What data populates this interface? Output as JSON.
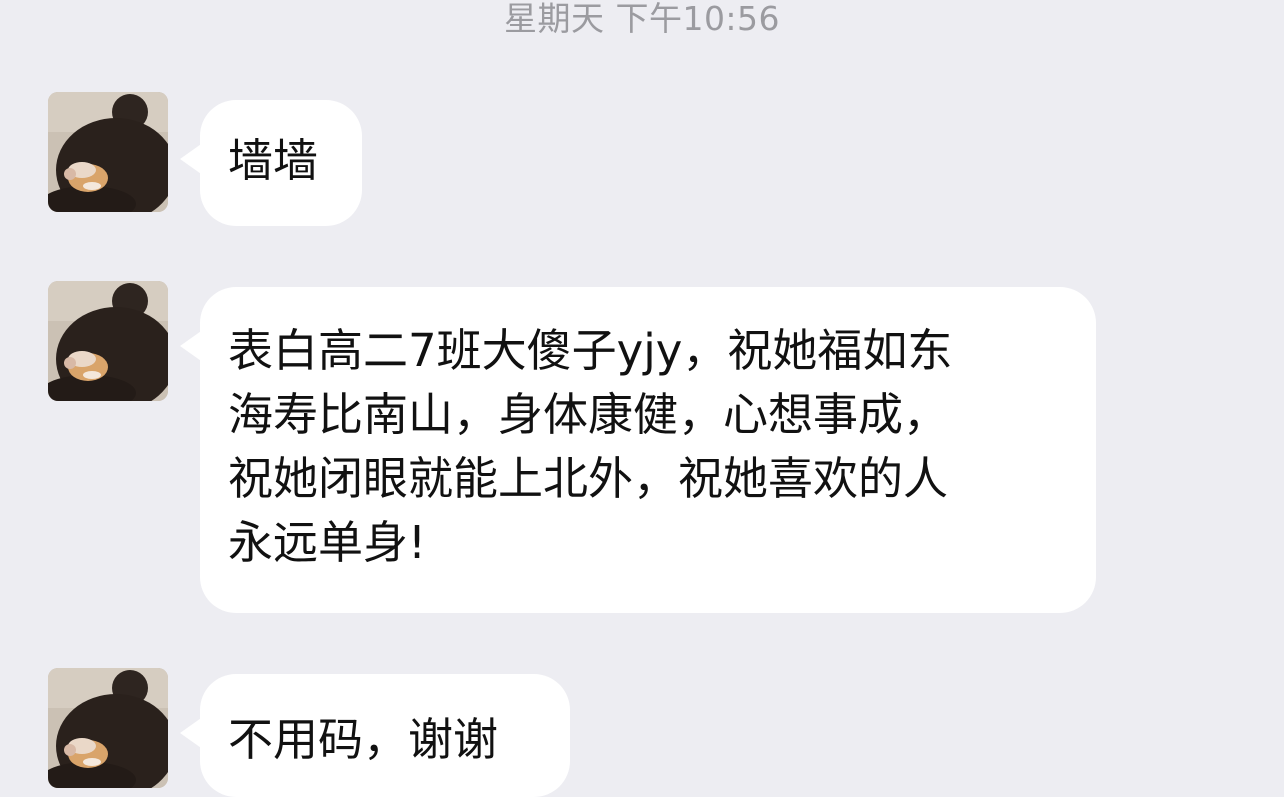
{
  "header": {
    "timestamp": "星期天 下午10:56"
  },
  "messages": [
    {
      "sender": "incoming",
      "avatar_icon": "bear-with-dog-avatar-icon",
      "text": "墙墙"
    },
    {
      "sender": "incoming",
      "avatar_icon": "bear-with-dog-avatar-icon",
      "text": "表白高二7班大傻子yjy，祝她福如东\n海寿比南山，身体康健，心想事成，\n祝她闭眼就能上北外，祝她喜欢的人\n永远单身!"
    },
    {
      "sender": "incoming",
      "avatar_icon": "bear-with-dog-avatar-icon",
      "text": "不用码，谢谢"
    }
  ],
  "colors": {
    "background": "#EDEDF2",
    "bubble": "#FFFFFF",
    "text": "#111111",
    "timestamp": "#9B9BA0"
  }
}
